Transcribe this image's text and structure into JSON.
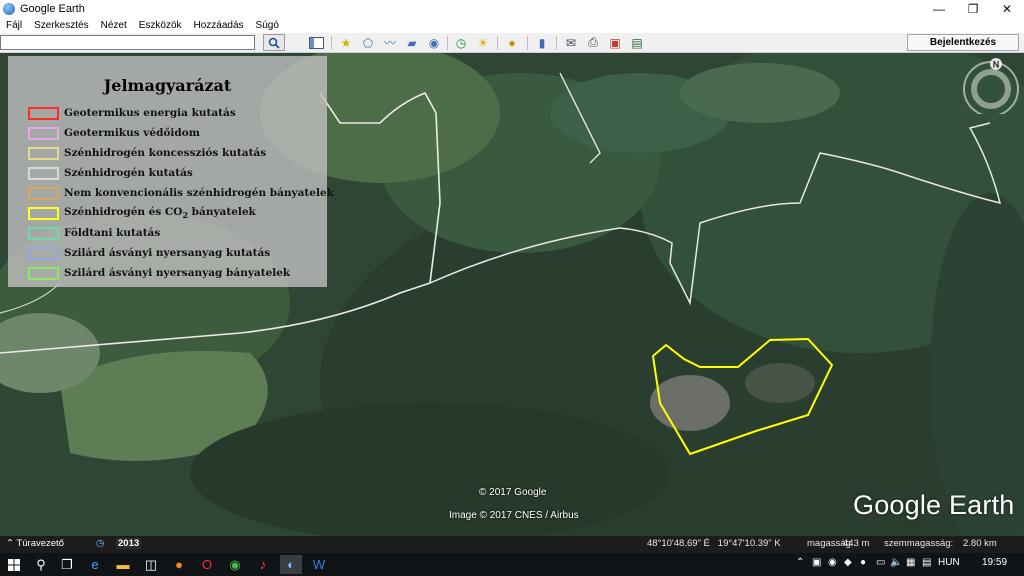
{
  "window": {
    "title": "Google Earth",
    "app_icon": "google-earth-icon"
  },
  "win_controls": {
    "minimize": "—",
    "restore": "❐",
    "close": "✕"
  },
  "menu": [
    "Fájl",
    "Szerkesztés",
    "Nézet",
    "Eszközök",
    "Hozzáadás",
    "Súgó"
  ],
  "toolbar": {
    "search_value": "",
    "search_icon": "search-icon",
    "login_label": "Bejelentkezés"
  },
  "legend": {
    "title": "Jelmagyarázat",
    "items": [
      {
        "label": "Geotermikus energia kutatás",
        "color": "#ff2a2a"
      },
      {
        "label": "Geotermikus védőidom",
        "color": "#e8a8e8"
      },
      {
        "label": "Szénhidrogén koncessziós kutatás",
        "color": "#e8d890"
      },
      {
        "label": "Szénhidrogén kutatás",
        "color": "#d8d8d8"
      },
      {
        "label": "Nem konvencionális szénhidrogén bányatelek",
        "color": "#d8a860"
      },
      {
        "label_prefix": "Szénhidrogén és CO",
        "label_sub": "2",
        "label_suffix": " bányatelek",
        "color": "#ffff20"
      },
      {
        "label": "Földtani kutatás",
        "color": "#70d8a8"
      },
      {
        "label": "Szilárd ásványi nyersanyag kutatás",
        "color": "#90a8e0"
      },
      {
        "label": "Szilárd ásványi nyersanyag bányatelek",
        "color": "#90e860"
      }
    ]
  },
  "compass": {
    "north": "N"
  },
  "map": {
    "copyright_1": "© 2017 Google",
    "copyright_2": "Image © 2017 CNES / Airbus",
    "logo": "Google Earth",
    "polygon_color": "#ffff00"
  },
  "status": {
    "tour_label": "Túravezető",
    "year": "2013",
    "coords": "48°10'48.69\" É   19°47'10.39\" K",
    "elevation_label": "magasság",
    "elevation_value": "443 m",
    "eye_label": "szemmagasság:",
    "eye_value": "2.80 km"
  },
  "taskbar": {
    "language": "HUN",
    "time": "19:59"
  }
}
